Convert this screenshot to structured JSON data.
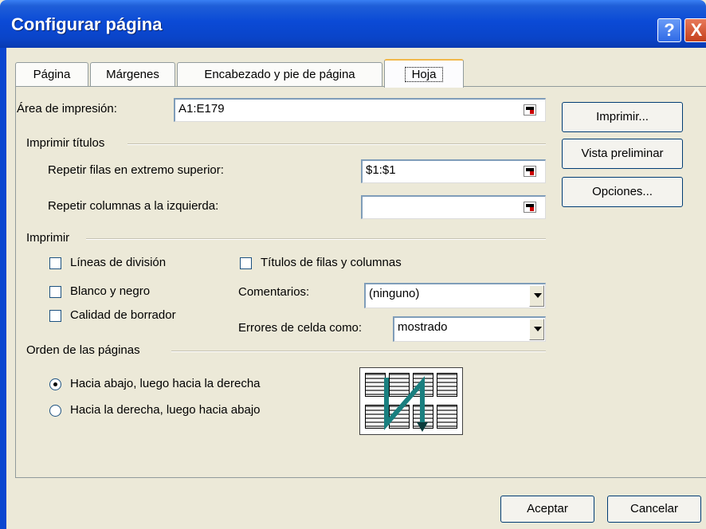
{
  "window": {
    "title": "Configurar página",
    "help": "?",
    "close": "X"
  },
  "tabs": [
    {
      "label": "Página"
    },
    {
      "label": "Márgenes"
    },
    {
      "label": "Encabezado y pie de página"
    },
    {
      "label": "Hoja"
    }
  ],
  "print_area": {
    "label": "Área de impresión:",
    "value": "A1:E179"
  },
  "print_titles": {
    "group": "Imprimir títulos",
    "rows_label": "Repetir filas en extremo superior:",
    "rows_value": "$1:$1",
    "cols_label": "Repetir columnas a la izquierda:",
    "cols_value": ""
  },
  "print": {
    "group": "Imprimir",
    "gridlines": "Líneas de división",
    "black_white": "Blanco y negro",
    "draft": "Calidad de borrador",
    "row_col_headings": "Títulos de filas y columnas",
    "comments_label": "Comentarios:",
    "comments_value": "(ninguno)",
    "errors_label": "Errores de celda como:",
    "errors_value": "mostrado"
  },
  "page_order": {
    "group": "Orden de las páginas",
    "down_then_over": "Hacia abajo, luego hacia la derecha",
    "over_then_down": "Hacia la derecha, luego hacia abajo"
  },
  "side_buttons": {
    "print": "Imprimir...",
    "preview": "Vista preliminar",
    "options": "Opciones..."
  },
  "footer": {
    "ok": "Aceptar",
    "cancel": "Cancelar"
  },
  "colors": {
    "title_bar": "#0a46d0",
    "dialog_bg": "#ece9d8",
    "arrow": "#1a7f7f"
  }
}
